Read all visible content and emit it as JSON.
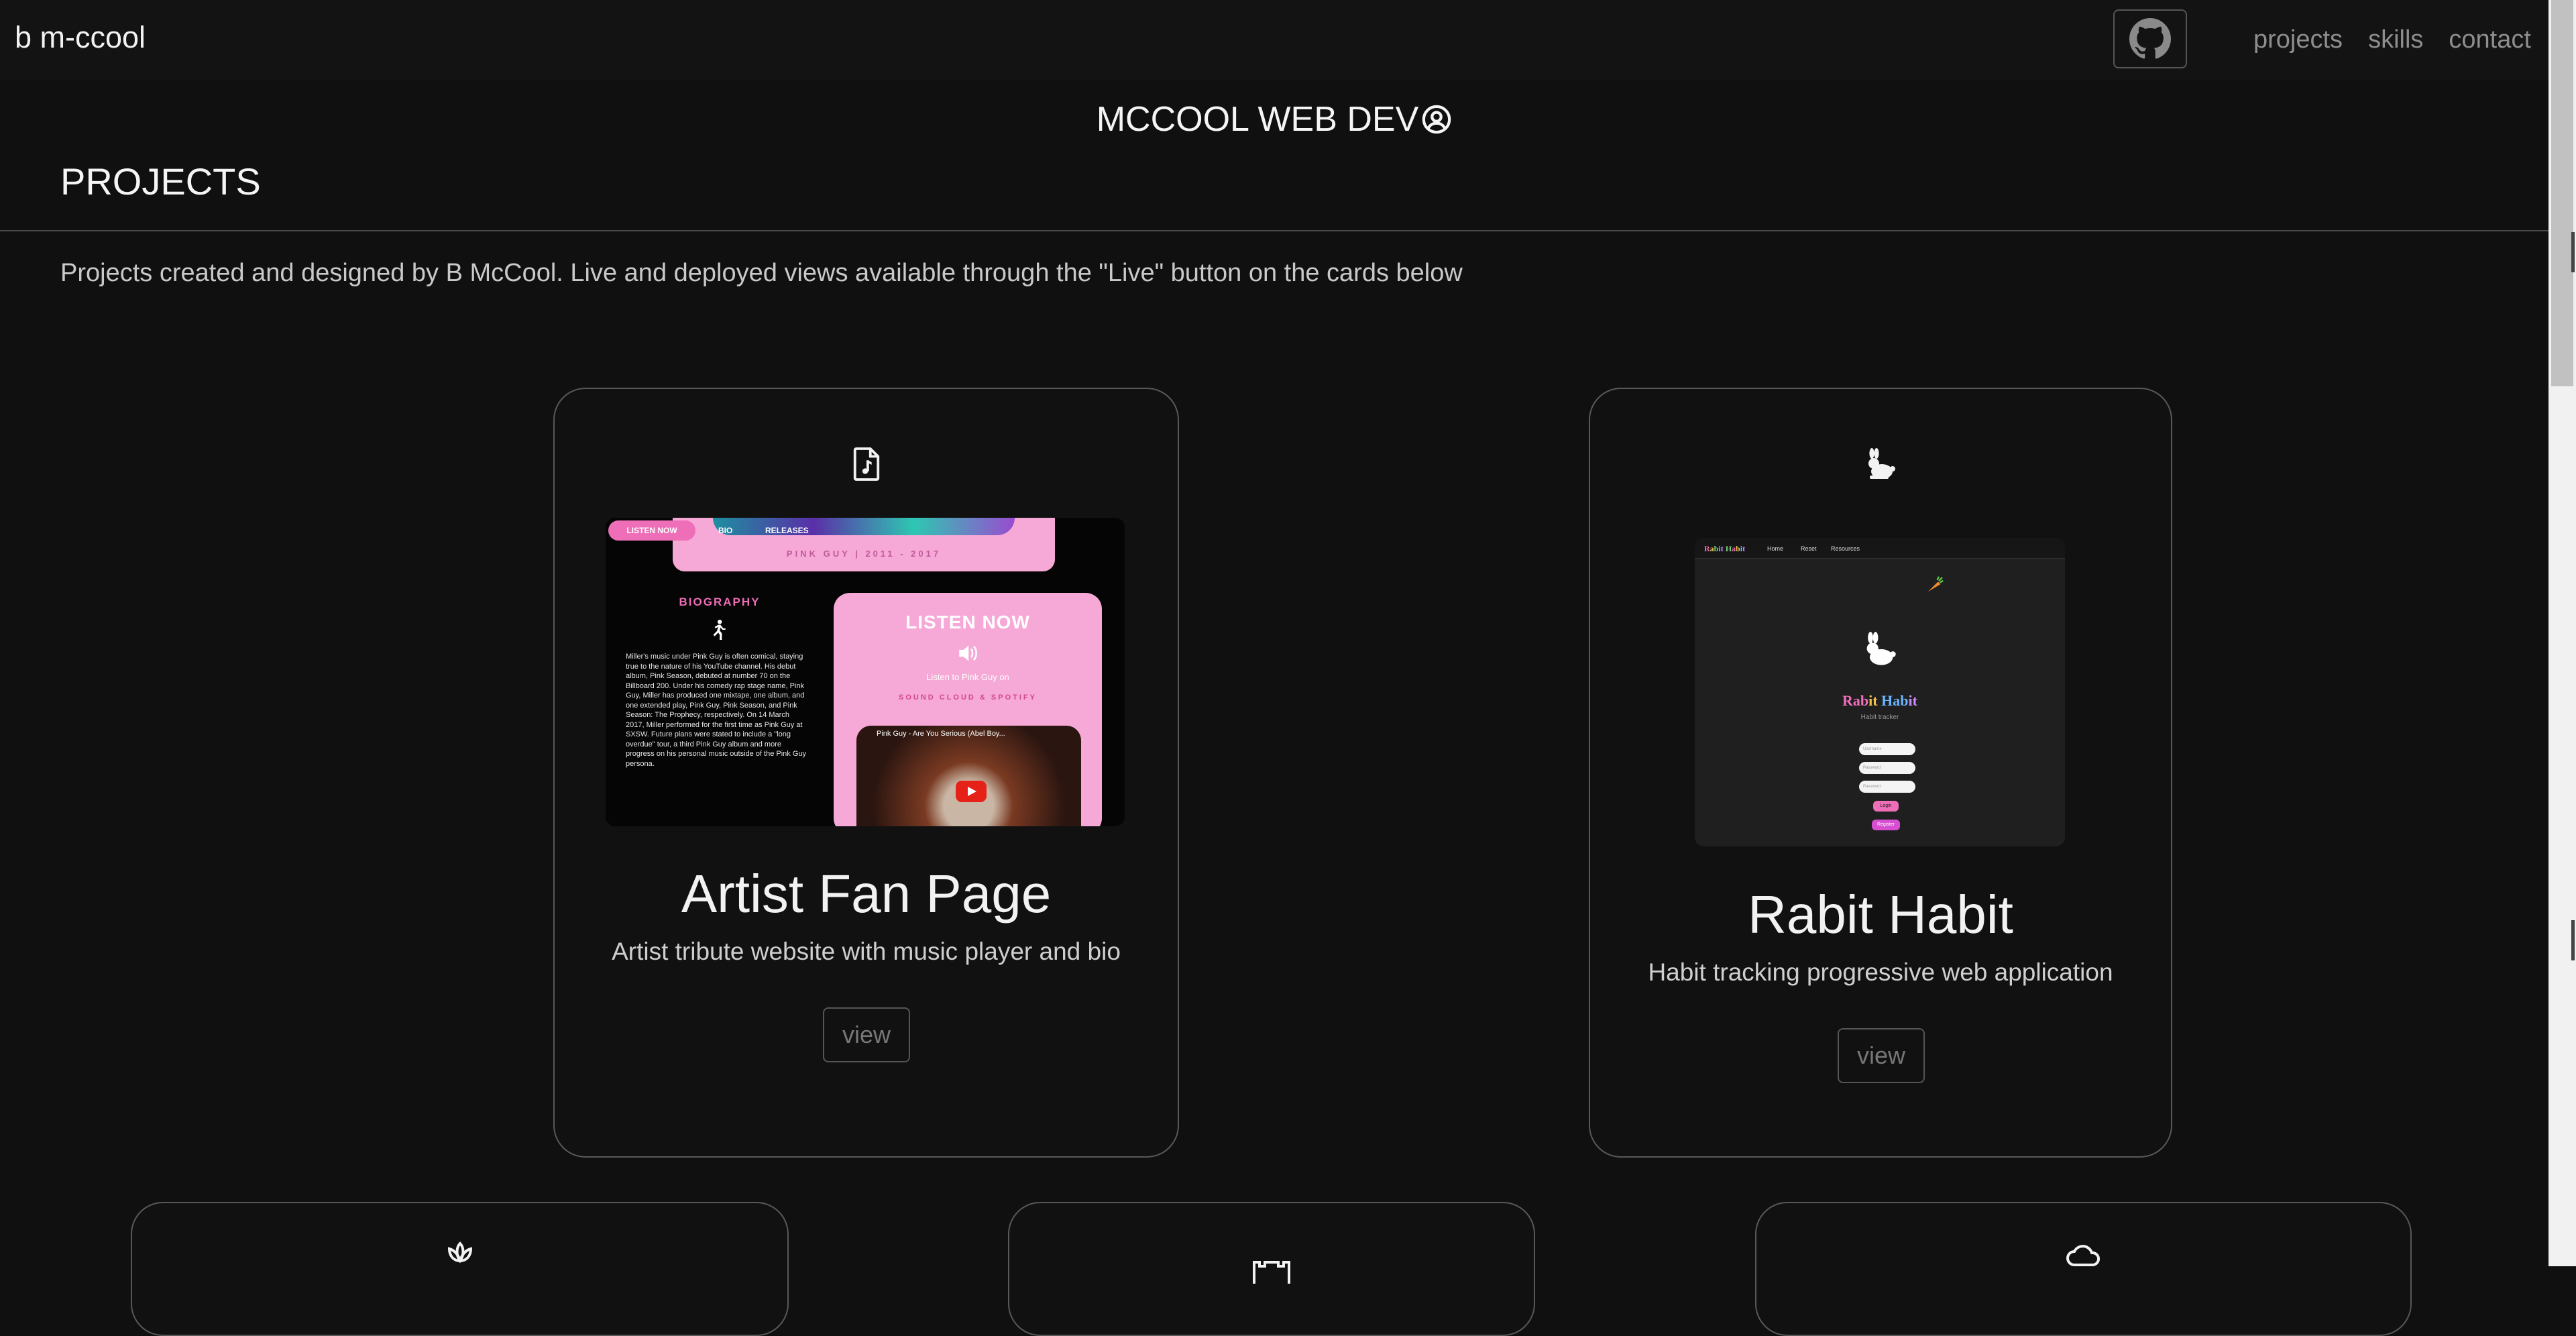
{
  "nav": {
    "brand": "b m-ccool",
    "github_icon": "github-icon",
    "links": [
      "projects",
      "skills",
      "contact"
    ]
  },
  "header": {
    "site_title": "MCCOOL WEB DEV",
    "title_icon": "user-circle-icon"
  },
  "section": {
    "title": "PROJECTS",
    "intro": "Projects created and designed by B McCool. Live and deployed views available through the \"Live\" button on the cards below"
  },
  "cards": [
    {
      "icon": "file-music-icon",
      "title": "Artist Fan Page",
      "description": "Artist tribute website with music player and bio",
      "button": "view",
      "preview": {
        "badge": "LISTEN NOW",
        "nav": [
          "BIO",
          "RELEASES"
        ],
        "banner": "PINK GUY | 2011 - 2017",
        "bio_heading": "BIOGRAPHY",
        "bio_text": "Miller's music under Pink Guy is often comical, staying true to the nature of his YouTube channel. His debut album, Pink Season, debuted at number 70 on the Billboard 200. Under his comedy rap stage name, Pink Guy, Miller has produced one mixtape, one album, and one extended play, Pink Guy, Pink Season, and Pink Season: The Prophecy, respectively. On 14 March 2017, Miller performed for the first time as Pink Guy at SXSW. Future plans were stated to include a \"long overdue\" tour, a third Pink Guy album and more progress on his personal music outside of the Pink Guy persona.",
        "listen_heading": "LISTEN NOW",
        "listen_sub": "Listen to Pink Guy on",
        "listen_links": "SOUND CLOUD & SPOTIFY",
        "video_title": "Pink Guy - Are You Serious (Abel Boy..."
      }
    },
    {
      "icon": "rabbit-icon",
      "title": "Rabit Habit",
      "description": "Habit tracking progressive web application",
      "button": "view",
      "preview": {
        "logo": "Rabit Habit",
        "nav": [
          "Home",
          "Reset",
          "Resources"
        ],
        "title": "Rabit Habit",
        "subtitle": "Habit tracker",
        "inputs": [
          "Username",
          "Password",
          "Password"
        ],
        "btn1": "Login",
        "btn2": "Register"
      }
    },
    {
      "icon": "lotus-icon"
    },
    {
      "icon": "castle-icon"
    },
    {
      "icon": "cloud-icon"
    }
  ],
  "colors": {
    "background": "#101010",
    "accent_pink": "#ee6eb8",
    "border": "#585858"
  }
}
